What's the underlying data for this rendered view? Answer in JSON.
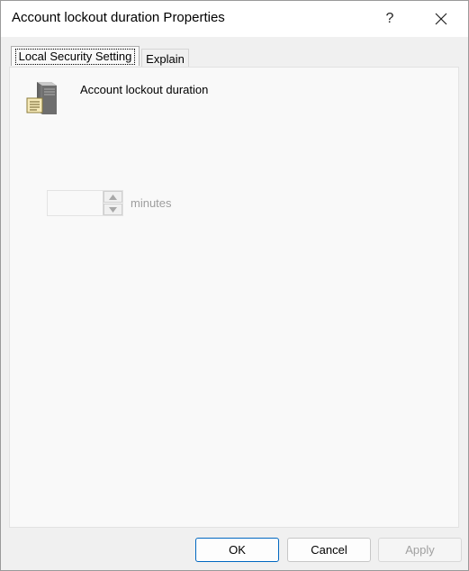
{
  "window": {
    "title": "Account lockout duration Properties",
    "help_glyph": "?"
  },
  "tabs": [
    {
      "label": "Local Security Setting",
      "selected": true
    },
    {
      "label": "Explain",
      "selected": false
    }
  ],
  "setting": {
    "icon": "server-policy-icon",
    "name": "Account lockout duration",
    "value": "",
    "unit": "minutes",
    "enabled": false
  },
  "buttons": {
    "ok": "OK",
    "cancel": "Cancel",
    "apply": "Apply"
  },
  "colors": {
    "accent": "#0067c0",
    "disabled_text": "#a0a0a0"
  }
}
